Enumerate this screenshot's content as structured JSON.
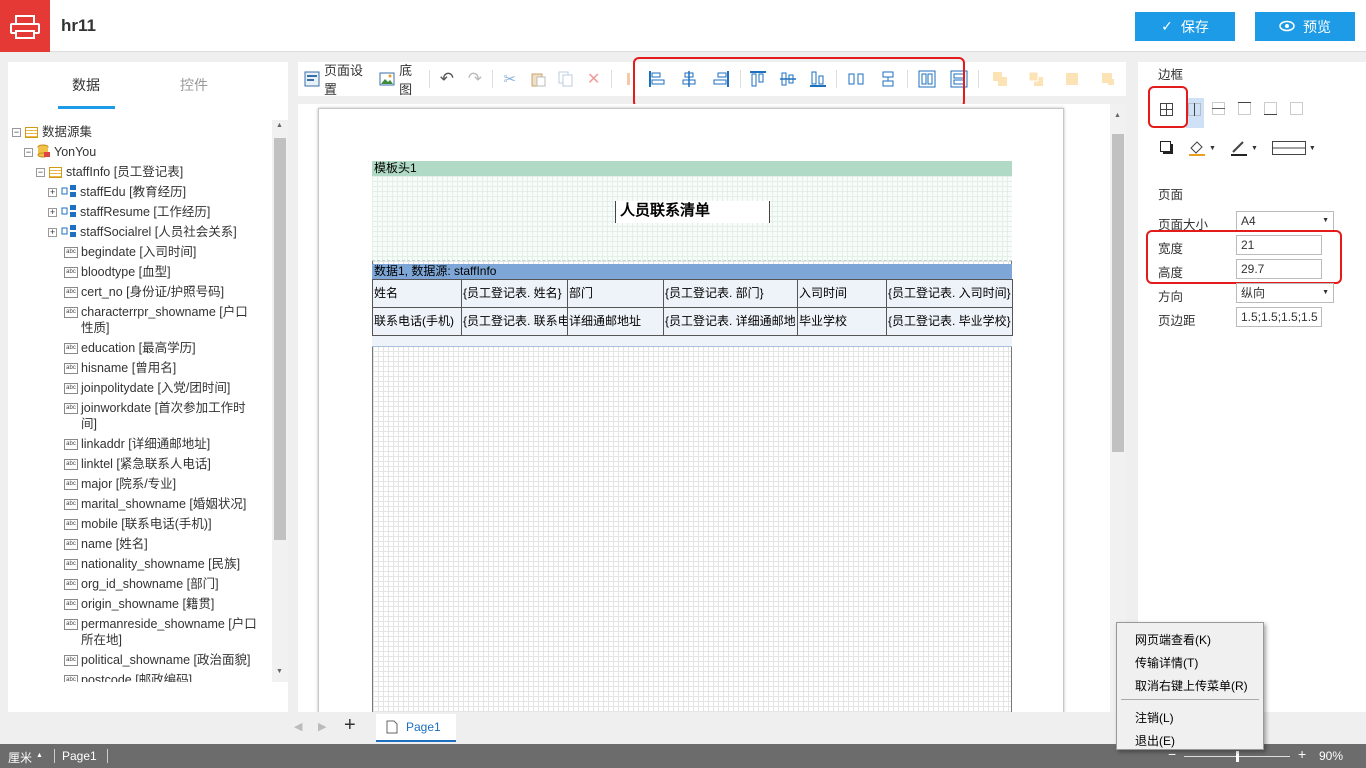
{
  "app": {
    "title": "hr11",
    "save_label": "保存",
    "preview_label": "预览"
  },
  "left_panel": {
    "tabs": [
      {
        "label": "数据",
        "active": true
      },
      {
        "label": "控件",
        "active": false
      }
    ],
    "tree": {
      "root": "数据源集",
      "datasource": "YonYou",
      "table": "staffInfo [员工登记表]",
      "subtables": [
        "staffEdu [教育经历]",
        "staffResume [工作经历]",
        "staffSocialrel [人员社会关系]"
      ],
      "fields": [
        {
          "l1": "begindate [入司时间]",
          "l2": ""
        },
        {
          "l1": "bloodtype [血型]",
          "l2": ""
        },
        {
          "l1": "cert_no [身份证/护照号码]",
          "l2": ""
        },
        {
          "l1": "characterrpr_showname [户口",
          "l2": "性质]"
        },
        {
          "l1": "education [最高学历]",
          "l2": ""
        },
        {
          "l1": "hisname [曾用名]",
          "l2": ""
        },
        {
          "l1": "joinpolitydate [入党/团时间]",
          "l2": ""
        },
        {
          "l1": "joinworkdate [首次参加工作时",
          "l2": "间]"
        },
        {
          "l1": "linkaddr [详细通邮地址]",
          "l2": ""
        },
        {
          "l1": "linktel [紧急联系人电话]",
          "l2": ""
        },
        {
          "l1": "major [院系/专业]",
          "l2": ""
        },
        {
          "l1": "marital_showname [婚姻状况]",
          "l2": ""
        },
        {
          "l1": "mobile [联系电话(手机)]",
          "l2": ""
        },
        {
          "l1": "name [姓名]",
          "l2": ""
        },
        {
          "l1": "nationality_showname [民族]",
          "l2": ""
        },
        {
          "l1": "org_id_showname [部门]",
          "l2": ""
        },
        {
          "l1": "origin_showname [籍贯]",
          "l2": ""
        },
        {
          "l1": "permanreside_showname [户口",
          "l2": "所在地]"
        },
        {
          "l1": "political_showname [政治面貌]",
          "l2": ""
        },
        {
          "l1": "postcode [邮政编码]",
          "l2": ""
        }
      ]
    }
  },
  "toolbar": {
    "page_setup": "页面设置",
    "background": "底图"
  },
  "report": {
    "header_band": "模板头1",
    "title": "人员联系清单",
    "data_band": "数据1, 数据源: staffInfo",
    "rows": [
      [
        "姓名",
        "{员工登记表. 姓名}",
        "部门",
        "{员工登记表. 部门}",
        "入司时间",
        "{员工登记表. 入司时间}"
      ],
      [
        "联系电话(手机)",
        "{员工登记表. 联系电",
        "详细通邮地址",
        "{员工登记表. 详细通邮地",
        "毕业学校",
        "{员工登记表. 毕业学校}"
      ]
    ]
  },
  "right_panel": {
    "border_title": "边框",
    "page_title": "页面",
    "page_size_label": "页面大小",
    "page_size": "A4",
    "width_label": "宽度",
    "width": "21",
    "height_label": "高度",
    "height": "29.7",
    "orientation_label": "方向",
    "orientation": "纵向",
    "margin_label": "页边距",
    "margin": "1.5;1.5;1.5;1.5"
  },
  "page_tabs": {
    "add": "+",
    "active": "Page1"
  },
  "status": {
    "unit": "厘米",
    "page": "Page1",
    "zoom": "90%",
    "zoom_fraction": 0.5
  },
  "context_menu": {
    "items": [
      "网页端查看(K)",
      "传输详情(T)",
      "取消右键上传菜单(R)",
      "注销(L)",
      "退出(E)"
    ]
  },
  "colors": {
    "accent": "#1e9be6",
    "brand": "#e53935",
    "highlight": "#e31b1b",
    "header_band": "#b0dac5",
    "data_band": "#7ea7d8"
  }
}
